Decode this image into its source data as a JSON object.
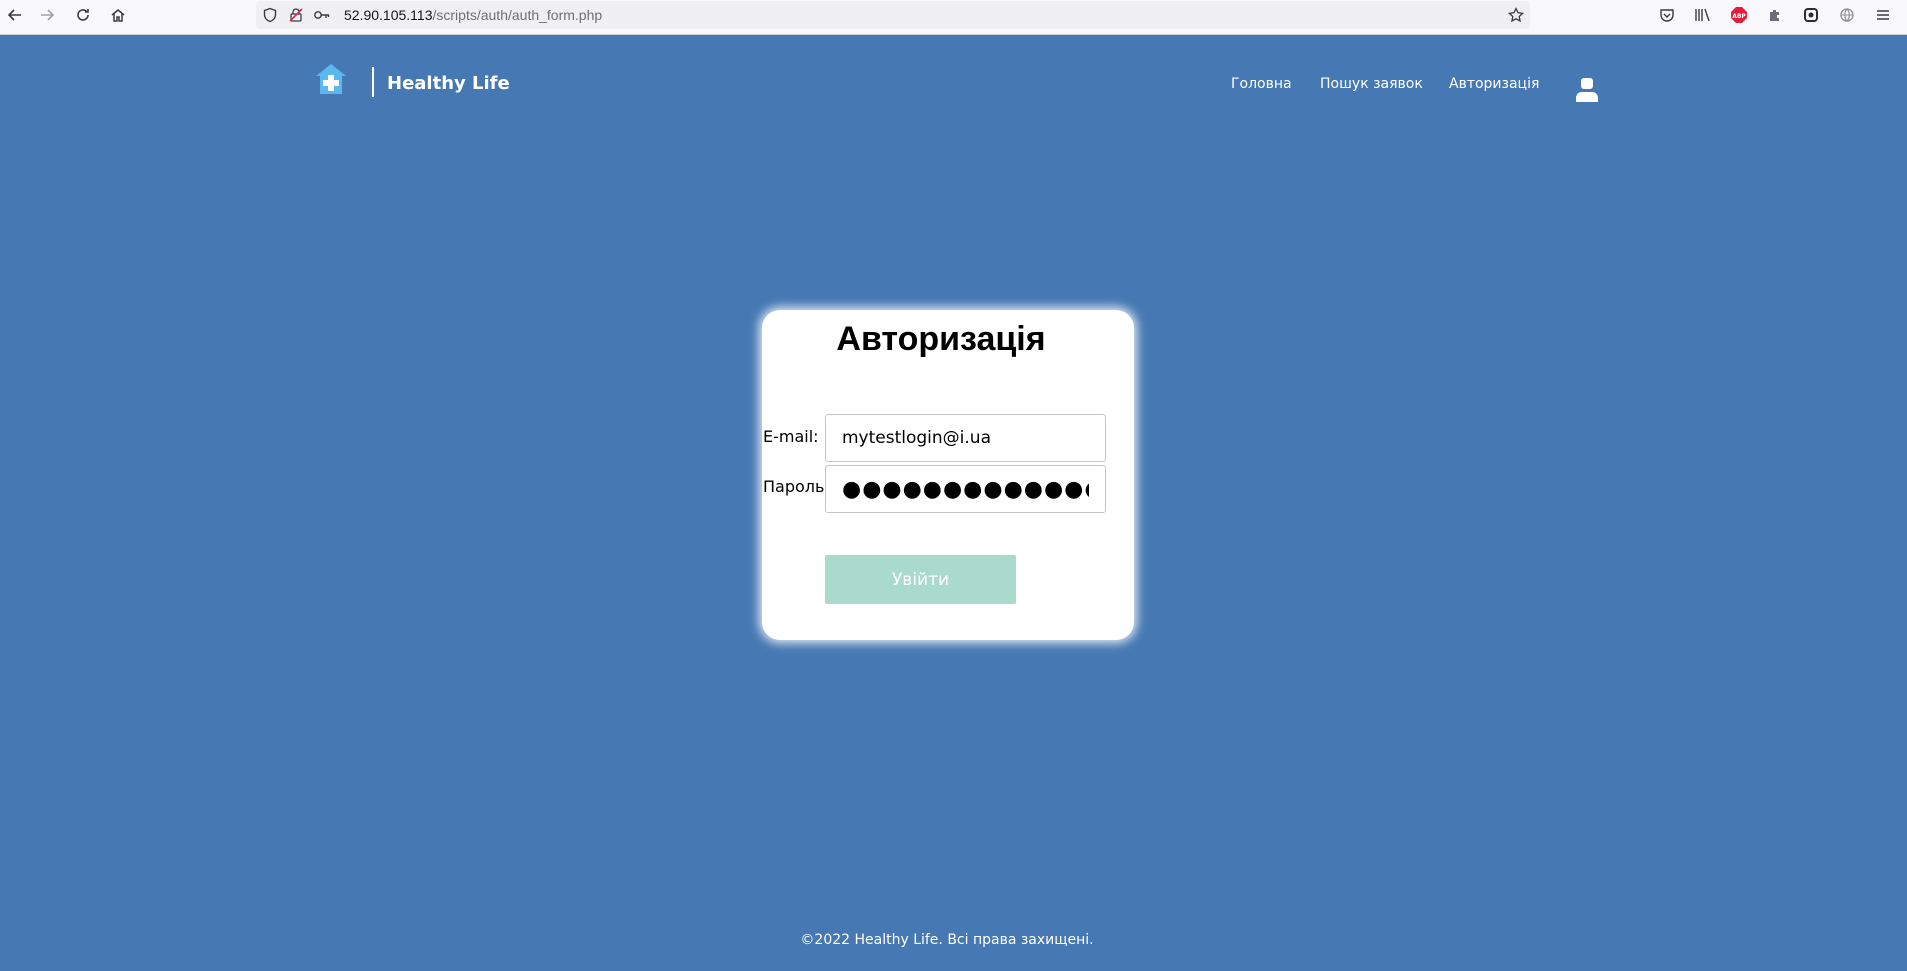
{
  "browser": {
    "url_host": "52.90.105.113",
    "url_path": "/scripts/auth/auth_form.php"
  },
  "header": {
    "logo_text": "Healthy Life",
    "nav": [
      {
        "label": "Головна"
      },
      {
        "label": "Пошук заявок"
      },
      {
        "label": "Авторизація"
      }
    ]
  },
  "auth": {
    "title": "Авторизація",
    "email_label": "E-mail:",
    "email_value": "mytestlogin@i.ua",
    "password_label": "Пароль:",
    "password_value": "●●●●●●●●●●●●●",
    "submit_label": "Увійти"
  },
  "footer": {
    "text": "©2022 Healthy Life. Всі права захищені."
  },
  "colors": {
    "background": "#4678b3",
    "button": "#a9dacb",
    "logo_accent": "#5ab8ef"
  }
}
